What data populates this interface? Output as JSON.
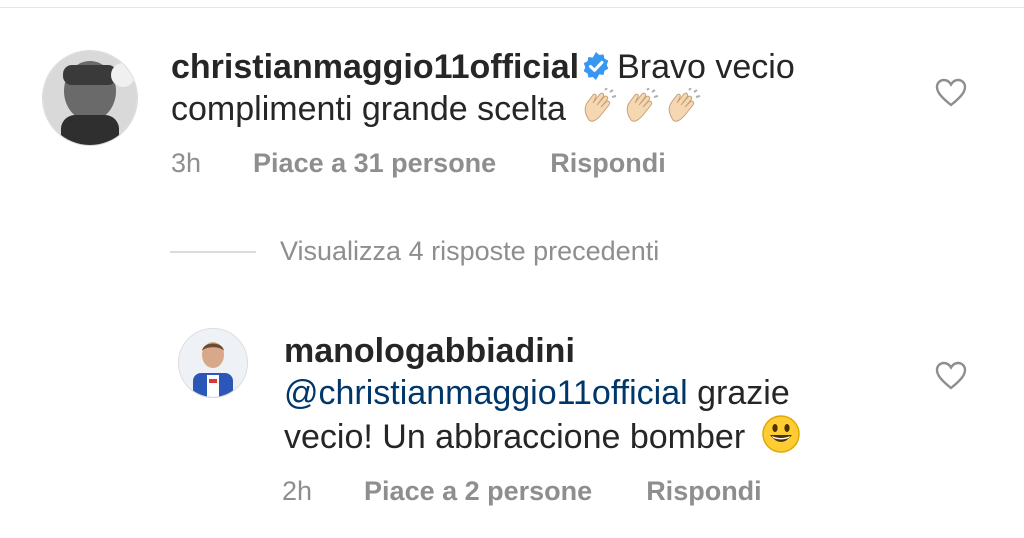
{
  "comments": [
    {
      "username": "christianmaggio11official",
      "verified": true,
      "text": "Bravo vecio",
      "text_line2": "complimenti grande scelta",
      "emoji": [
        "clapping-hands",
        "clapping-hands",
        "clapping-hands"
      ],
      "time": "3h",
      "likes": "Piace a 31 persone",
      "reply": "Rispondi"
    },
    {
      "username": "manologabbiadini",
      "mention": "@christianmaggio11official",
      "text": "grazie",
      "text_line2": "vecio! Un abbraccione bomber",
      "emoji": [
        "grinning-face"
      ],
      "time": "2h",
      "likes": "Piace a 2 persone",
      "reply": "Rispondi"
    }
  ],
  "view_replies": "Visualizza 4 risposte precedenti",
  "colors": {
    "text": "#262626",
    "muted": "#8e8e8e",
    "mention": "#00376b",
    "verified": "#3897f0"
  }
}
